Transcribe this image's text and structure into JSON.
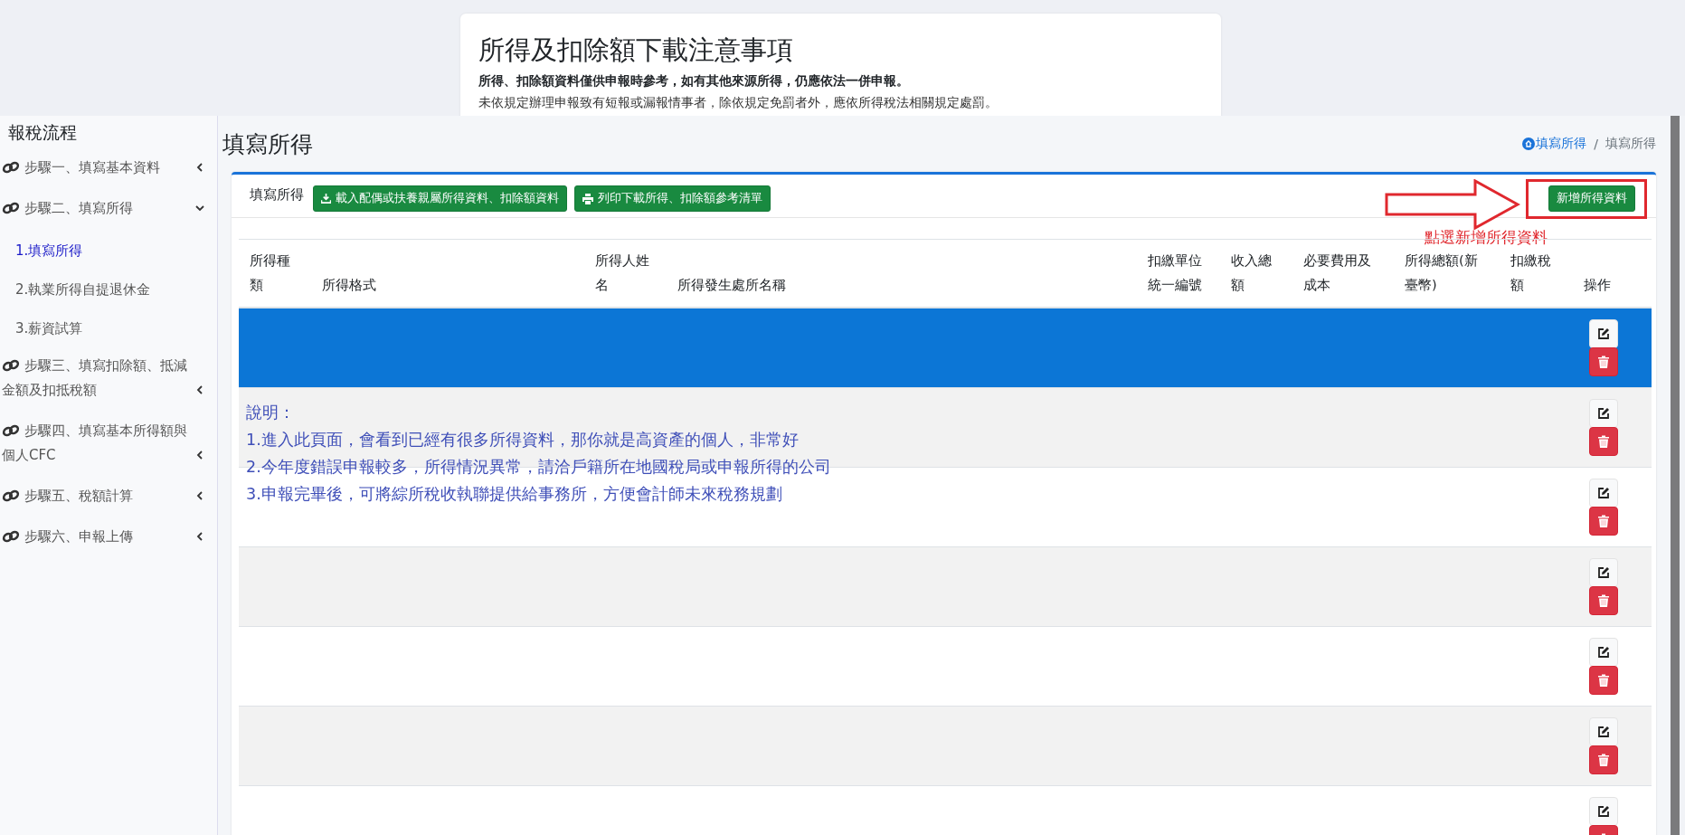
{
  "notice": {
    "title": "所得及扣除額下載注意事項",
    "bold_line": "所得、扣除額資料僅供申報時參考，如有其他來源所得，仍應依法一併申報。",
    "line": "未依規定辦理申報致有短報或漏報情事者，除依規定免罰者外，應依所得稅法相關規定處罰。"
  },
  "sidebar": {
    "title": "報稅流程",
    "items": [
      {
        "label": "步驟一、填寫基本資料",
        "expanded": false
      },
      {
        "label": "步驟二、填寫所得",
        "expanded": true,
        "children": [
          {
            "label": "1.填寫所得",
            "selected": true
          },
          {
            "label": "2.執業所得自提退休金",
            "selected": false
          },
          {
            "label": "3.薪資試算",
            "selected": false
          }
        ]
      },
      {
        "label": "步驟三、填寫扣除額、抵減金額及扣抵稅額",
        "expanded": false
      },
      {
        "label": "步驟四、填寫基本所得額與個人CFC",
        "expanded": false
      },
      {
        "label": "步驟五、稅額計算",
        "expanded": false
      },
      {
        "label": "步驟六、申報上傳",
        "expanded": false
      }
    ]
  },
  "page": {
    "title": "填寫所得",
    "breadcrumb": [
      {
        "label": "填寫所得",
        "kind": "link"
      },
      {
        "label": "/",
        "kind": "separator"
      },
      {
        "label": "填寫所得",
        "kind": "current"
      }
    ]
  },
  "card": {
    "label": "填寫所得",
    "buttons": [
      {
        "label": "載入配偶或扶養親屬所得資料、扣除額資料",
        "kind": "download"
      },
      {
        "label": "列印下載所得、扣除額參考清單",
        "kind": "print"
      }
    ],
    "add_button": "新增所得資料",
    "annotation": "點選新增所得資料"
  },
  "table": {
    "columns": [
      "所得種類",
      "所得格式",
      "所得人姓名",
      "所得發生處所名稱",
      "扣繳單位統一編號",
      "收入總額",
      "必要費用及成本",
      "所得總額(新臺幣)",
      "扣繳稅額",
      "操作"
    ],
    "rows": [
      {
        "selected": true
      },
      {
        "selected": false
      },
      {
        "selected": false
      },
      {
        "selected": false
      },
      {
        "selected": false
      },
      {
        "selected": false
      },
      {
        "selected": false
      }
    ]
  },
  "note": {
    "title": "說明：",
    "lines": [
      "1.進入此頁面，會看到已經有很多所得資料，那你就是高資產的個人，非常好",
      "2.今年度錯誤申報較多，所得情況異常，請洽戶籍所在地國稅局或申報所得的公司",
      "3.申報完畢後，可將綜所稅收執聯提供給事務所，方便會計師未來稅務規劃"
    ]
  }
}
